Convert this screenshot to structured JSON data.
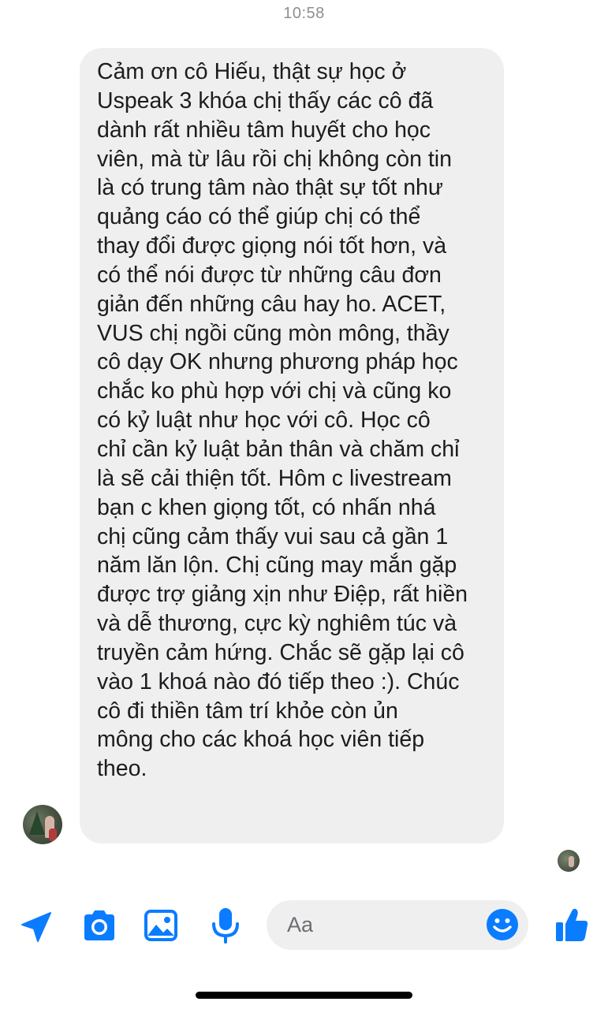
{
  "timestamp": "10:58",
  "message": {
    "lines": [
      "Cảm ơn cô Hiếu, thật sự học ở",
      "Uspeak 3 khóa chị thấy các cô đã",
      "dành rất nhiều tâm huyết cho học",
      "viên, mà từ lâu rồi chị không còn tin",
      "là có trung tâm nào thật sự tốt như",
      "quảng cáo có thể giúp chị có thể",
      "thay đổi được giọng nói tốt hơn, và",
      "có thể nói được từ những câu đơn",
      "giản đến những câu hay ho. ACET,",
      "VUS chị ngồi cũng mòn mông, thầy",
      "cô dạy OK nhưng phương pháp học",
      "chắc ko phù hợp với chị và cũng ko",
      "có kỷ luật như học với cô. Học cô",
      "chỉ cần kỷ luật bản thân và chăm chỉ",
      "là sẽ cải thiện tốt. Hôm c livestream",
      "bạn c khen giọng tốt, có nhấn nhá",
      "chị cũng cảm thấy vui sau cả gần 1",
      "năm lăn lộn. Chị cũng may mắn gặp",
      "được trợ giảng xịn như Điệp, rất hiền",
      "và dễ thương, cực kỳ nghiêm túc và",
      "truyền cảm hứng. Chắc sẽ gặp lại cô",
      "vào 1 khoá nào đó tiếp theo :). Chúc",
      "cô đi thiền tâm trí khỏe còn ủn",
      "mông cho các khoá học viên tiếp",
      "theo."
    ]
  },
  "composer": {
    "placeholder": "Aa",
    "icons": [
      "location-arrow-icon",
      "camera-icon",
      "image-icon",
      "microphone-icon",
      "emoji-icon",
      "thumbs-up-icon"
    ]
  },
  "colors": {
    "accent": "#0a7cff",
    "bubble": "#efeff0",
    "text": "#1c1c1e",
    "timestamp": "#8e8e93"
  }
}
